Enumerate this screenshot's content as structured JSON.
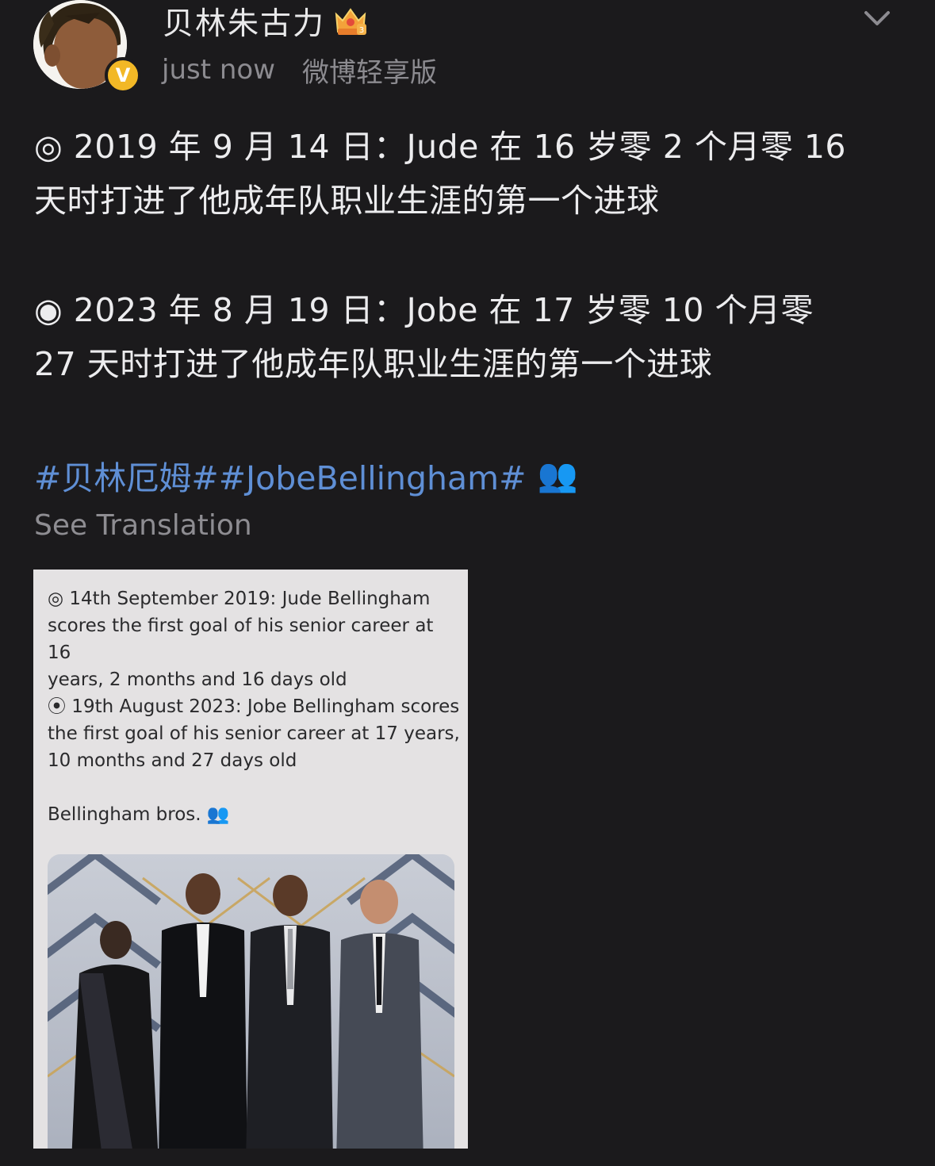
{
  "header": {
    "username": "贝林朱古力",
    "timestamp": "just now",
    "source": "微博轻享版",
    "verified_badge": "V",
    "avatar_icon": "cartoon-avatar-icon",
    "crown_icon": "crown-level-icon",
    "menu_icon": "chevron-down-icon"
  },
  "post": {
    "line1": "◎ 2019 年 9 月 14 日：Jude 在 16 岁零 2 个月零 16",
    "line2": "天时打进了他成年队职业生涯的第一个进球",
    "line3": "◉ 2023 年 8 月 19 日：Jobe 在 17 岁零 10 个月零",
    "line4": "27 天时打进了他成年队职业生涯的第一个进球",
    "hashtags": "#贝林厄姆##JobeBellingham#",
    "hashtag_emoji": "👥",
    "see_translation": "See Translation"
  },
  "embed": {
    "para1": "◎ 14th September 2019: Jude Bellingham\nscores the first goal of his senior career at 16\nyears, 2 months and 16 days old",
    "para2": "⦿ 19th August 2023: Jobe Bellingham scores\nthe first goal of his senior career at 17 years,\n10 months and 27 days old",
    "para3": "Bellingham bros. 👥",
    "photo": "family-photo"
  },
  "colors": {
    "background": "#1b1a1c",
    "text": "#ececee",
    "muted": "#8c8b90",
    "link": "#5f8fd5",
    "badge": "#f2b826"
  }
}
